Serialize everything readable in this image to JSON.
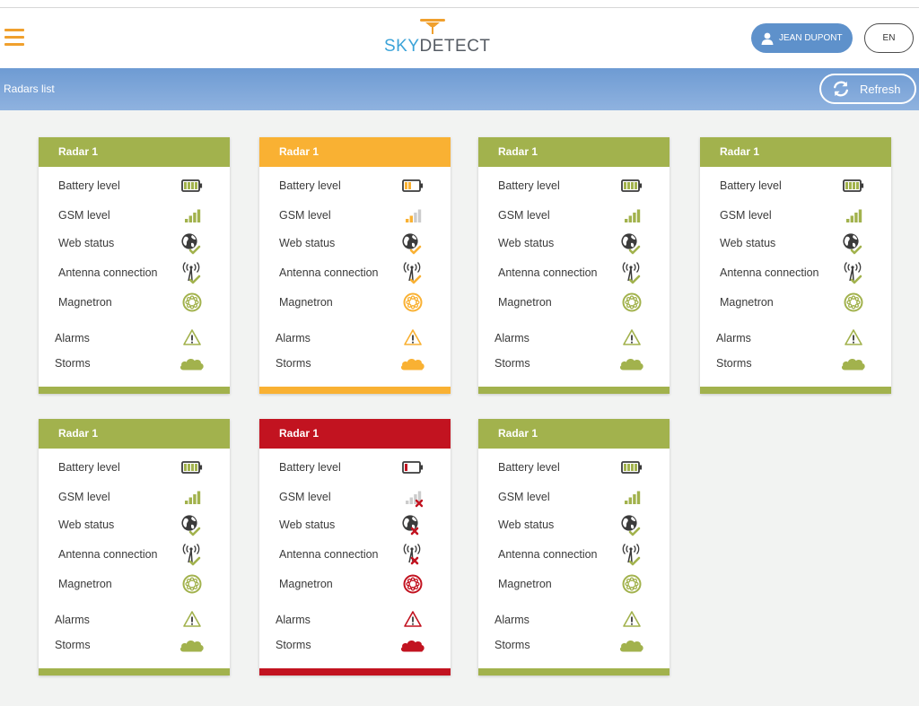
{
  "header": {
    "logo_sky": "SKY",
    "logo_detect": "DETECT",
    "user_label": "JEAN DUPONT",
    "lang_label": "EN"
  },
  "toolbar": {
    "title": "Radars list",
    "refresh_label": "Refresh"
  },
  "colors": {
    "ok": "#a2b24d",
    "warning": "#f9b133",
    "error": "#c21320",
    "brand_blue": "#3ba3d8",
    "brand_orange": "#f0a02d",
    "user_button": "#5e91cb"
  },
  "labels": {
    "battery": "Battery level",
    "gsm": "GSM level",
    "web": "Web status",
    "antenna": "Antenna connection",
    "magnetron": "Magnetron",
    "alarms": "Alarms",
    "storms": "Storms"
  },
  "icons": {
    "battery": "battery-icon",
    "gsm": "signal-bars-icon",
    "web": "globe-icon",
    "antenna": "antenna-icon",
    "magnetron": "magnetron-icon",
    "alarms": "warning-triangle-icon",
    "storms": "cloud-icon"
  },
  "radars": [
    {
      "name": "Radar 1",
      "status": "ok"
    },
    {
      "name": "Radar 1",
      "status": "warning"
    },
    {
      "name": "Radar 1",
      "status": "ok"
    },
    {
      "name": "Radar 1",
      "status": "ok"
    },
    {
      "name": "Radar 1",
      "status": "ok"
    },
    {
      "name": "Radar 1",
      "status": "error"
    },
    {
      "name": "Radar 1",
      "status": "ok"
    }
  ]
}
